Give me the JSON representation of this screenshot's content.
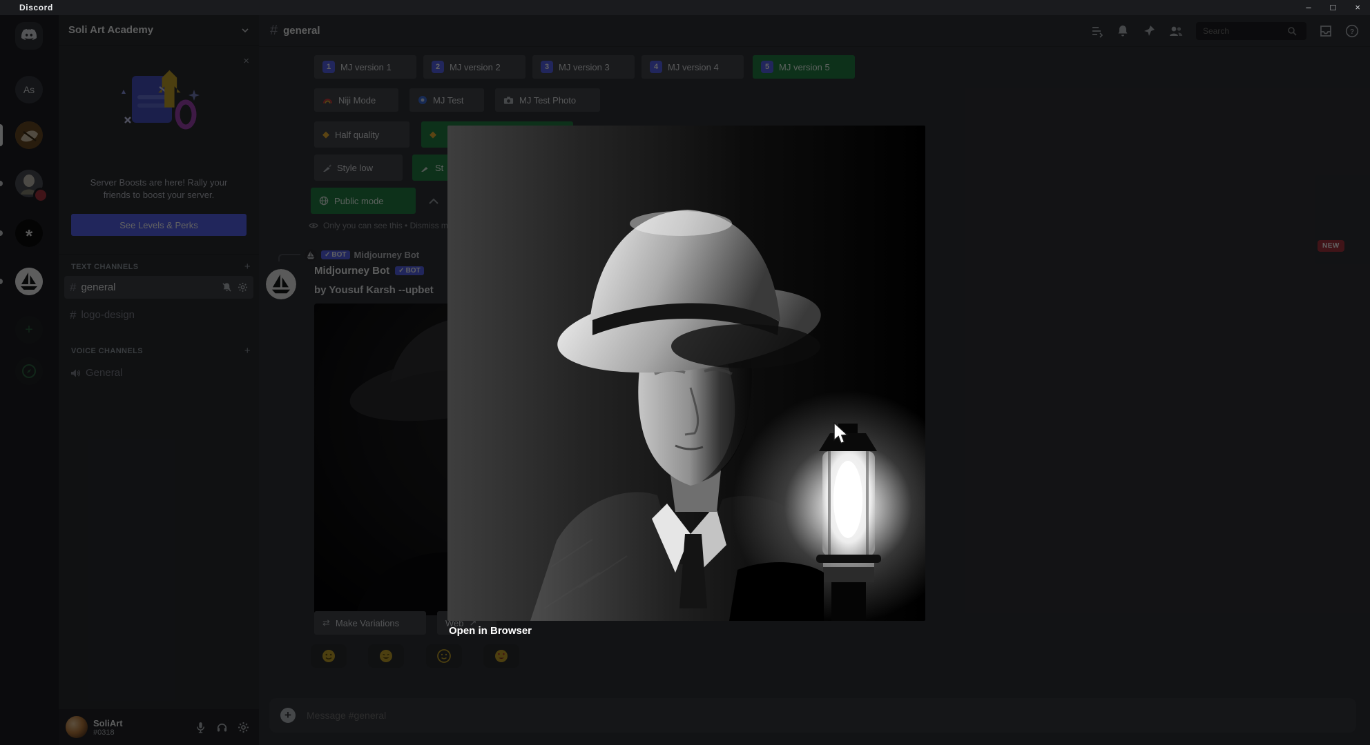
{
  "titlebar": {
    "app_name": "Discord",
    "minimize": "–",
    "maximize": "□",
    "close": "×"
  },
  "rail": {
    "servers": [
      {
        "name": "discord-home"
      },
      {
        "name": "server-as",
        "initials": "As"
      },
      {
        "name": "server-soli-art-academy-selected"
      },
      {
        "name": "server-art-portrait",
        "badge": true
      },
      {
        "name": "server-chatgpt",
        "glyph": "*"
      },
      {
        "name": "server-midjourney"
      }
    ]
  },
  "sidebar": {
    "server_name": "Soli Art Academy",
    "boost": {
      "line1": "Server Boosts are here! Rally your",
      "line2": "friends to boost your server.",
      "cta": "See Levels & Perks",
      "close": "×"
    },
    "add": "+",
    "text_channels_label": "TEXT CHANNELS",
    "voice_channels_label": "VOICE CHANNELS",
    "channels": [
      {
        "name": "general"
      },
      {
        "name": "logo-design"
      }
    ],
    "voice_channels": [
      {
        "name": "General"
      }
    ],
    "user": {
      "name": "SoliArt",
      "tag": "#0318"
    }
  },
  "header": {
    "channel_name": "general",
    "search_placeholder": "Search"
  },
  "settings_message": {
    "version_buttons": [
      {
        "num": "1",
        "label": "MJ version 1"
      },
      {
        "num": "2",
        "label": "MJ version 2"
      },
      {
        "num": "3",
        "label": "MJ version 3"
      },
      {
        "num": "4",
        "label": "MJ version 4"
      },
      {
        "num": "5",
        "label": "MJ version 5",
        "selected": true
      }
    ],
    "mode_buttons": [
      {
        "label": "Niji Mode",
        "icon": "rainbow-icon"
      },
      {
        "label": "MJ Test",
        "icon": "test-icon"
      },
      {
        "label": "MJ Test Photo",
        "icon": "camera-icon"
      }
    ],
    "quality_row": {
      "left": "Half quality",
      "left_icon": "diamond-icon"
    },
    "style_row": {
      "left": "Style low",
      "right_fragment": "St"
    },
    "privacy_row": {
      "label": "Public mode",
      "icon": "globe-icon"
    },
    "ephemeral_note": "Only you can see this • Dismiss message"
  },
  "image_message": {
    "reply_author": "Midjourney Bot",
    "bot_badge": "BOT",
    "author": "Midjourney Bot",
    "text": "by Yousuf Karsh --upbet",
    "actions": [
      {
        "label": "Make Variations",
        "icon": "shuffle-icon"
      },
      {
        "label": "Web",
        "icon": "external-link-icon"
      }
    ],
    "reactions": [
      {
        "icon": "smiling-face-emoji"
      },
      {
        "icon": "grinning-face-emoji"
      },
      {
        "icon": "slightly-smiling-face-emoji"
      },
      {
        "icon": "heart-eyes-face-emoji"
      }
    ]
  },
  "composer": {
    "placeholder": "Message #general"
  },
  "lightbox": {
    "caption": "Open in Browser",
    "image_description": "black-and-white portrait of an elderly man in a fedora lit by a glowing lantern"
  },
  "badges": {
    "new_label": "NEW"
  },
  "colors": {
    "dim_overlay": "rgba(0,0,0,0.62)",
    "success_green": "#248046",
    "blurple": "#5865f2",
    "badge_red": "#a8353f",
    "rail_bg": "#1e1f22",
    "sidebar_bg": "#2b2d31",
    "chat_bg": "#313338"
  }
}
